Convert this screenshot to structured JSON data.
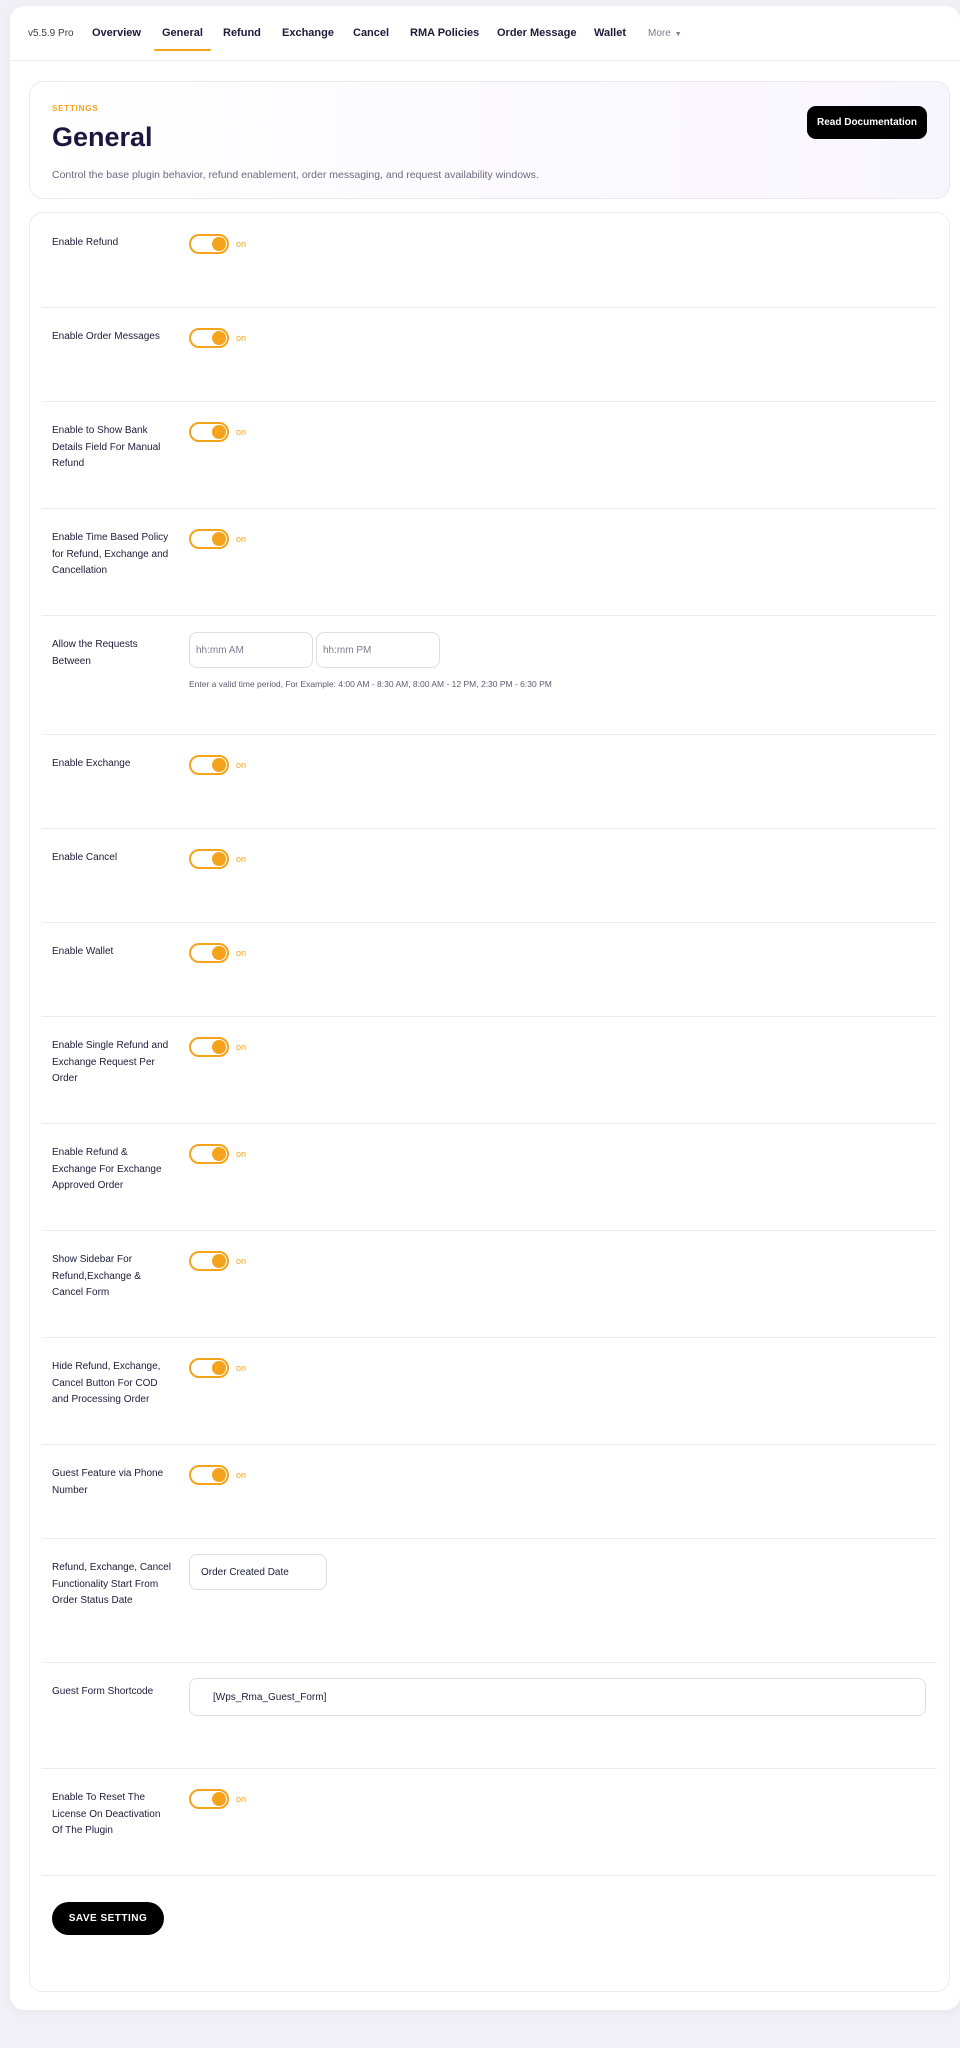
{
  "nav": {
    "version": "v5.5.9 Pro",
    "tabs": [
      {
        "label": "Overview"
      },
      {
        "label": "General",
        "active": true
      },
      {
        "label": "Refund"
      },
      {
        "label": "Exchange"
      },
      {
        "label": "Cancel"
      },
      {
        "label": "RMA Policies"
      },
      {
        "label": "Order Message"
      },
      {
        "label": "Wallet"
      }
    ],
    "more_label": "More"
  },
  "header": {
    "eyebrow": "SETTINGS",
    "title": "General",
    "description": "Control the base plugin behavior, refund enablement, order messaging, and request availability windows.",
    "doc_button": "Read Documentation"
  },
  "settings": {
    "toggle_state_text": "on",
    "rows": [
      {
        "label": "Enable Refund",
        "type": "toggle",
        "on": true
      },
      {
        "label": "Enable Order Messages",
        "type": "toggle",
        "on": true
      },
      {
        "label": "Enable to Show Bank Details Field For Manual Refund",
        "type": "toggle",
        "on": true
      },
      {
        "label": "Enable Time Based Policy for Refund, Exchange and Cancellation",
        "type": "toggle",
        "on": true
      },
      {
        "label": "Allow the Requests Between",
        "type": "time-range",
        "start_placeholder": "hh:mm AM",
        "end_placeholder": "hh:mm PM",
        "help": "Enter a valid time period, For Example: 4:00 AM - 8:30 AM, 8:00 AM - 12 PM, 2:30 PM - 6:30 PM"
      },
      {
        "label": "Enable Exchange",
        "type": "toggle",
        "on": true
      },
      {
        "label": "Enable Cancel",
        "type": "toggle",
        "on": true
      },
      {
        "label": "Enable Wallet",
        "type": "toggle",
        "on": true
      },
      {
        "label": "Enable Single Refund and Exchange Request Per Order",
        "type": "toggle",
        "on": true
      },
      {
        "label": "Enable Refund & Exchange For Exchange Approved Order",
        "type": "toggle",
        "on": true
      },
      {
        "label": "Show Sidebar For Refund,Exchange & Cancel Form",
        "type": "toggle",
        "on": true
      },
      {
        "label": "Hide Refund, Exchange, Cancel Button For COD and Processing Order",
        "type": "toggle",
        "on": true
      },
      {
        "label": "Guest Feature via Phone Number",
        "type": "toggle",
        "on": true
      },
      {
        "label": "Refund, Exchange, Cancel Functionality Start From Order Status Date",
        "type": "select",
        "value": "Order Created Date"
      },
      {
        "label": "Guest Form Shortcode",
        "type": "text",
        "value": "[Wps_Rma_Guest_Form]"
      },
      {
        "label": "Enable To Reset The License On Deactivation Of The Plugin",
        "type": "toggle",
        "on": true
      }
    ],
    "save_label": "SAVE SETTING"
  },
  "colors": {
    "accent": "#f5a31a",
    "primary_text": "#1d1740",
    "button_bg": "#000000"
  }
}
